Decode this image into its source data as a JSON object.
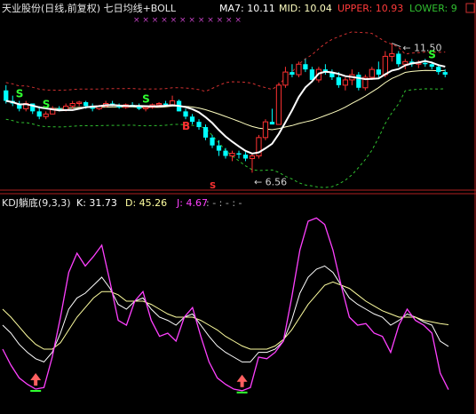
{
  "header": {
    "title": "天业股份(日线,前复权) 七日均线+BOLL",
    "ma7_label": "MA7: 10.11",
    "mid_label": "MID: 10.04",
    "upper_label": "UPPER: 10.93",
    "lower_label": "LOWER: 9",
    "header_marks": "× × × × × × × × × × × ×"
  },
  "kdj_header": {
    "name": "KDJ躺底(9,3,3)",
    "k_label": "K: 31.73",
    "d_label": "D: 45.26",
    "j_label": "J: 4.67",
    "tail": ": - : - : -"
  },
  "colors": {
    "bg": "#000000",
    "up": "#ff3232",
    "down": "#00ffff",
    "ma7": "#ffffff",
    "mid": "#ffffc0",
    "upper": "#d03030",
    "lower": "#30c030",
    "k": "#ffffff",
    "d": "#ffffa0",
    "j": "#ff40ff",
    "arrow_up": "#ff6060",
    "sell": "#30ff30"
  },
  "chart_data": [
    {
      "type": "candlestick",
      "title": "天业股份(日线,前复权) 七日均线+BOLL",
      "series": [
        {
          "name": "MA7",
          "last": 10.11
        },
        {
          "name": "MID",
          "last": 10.04
        },
        {
          "name": "UPPER",
          "last": 10.93
        },
        {
          "name": "LOWER",
          "last": 9
        }
      ],
      "annotations": [
        {
          "text": "11.50",
          "kind": "high"
        },
        {
          "text": "6.56",
          "kind": "low"
        }
      ],
      "signals": [
        "S",
        "S",
        "S",
        "B",
        "S"
      ],
      "ohlc": [
        [
          9.7,
          9.9,
          9.2,
          9.3
        ],
        [
          9.3,
          9.5,
          9.1,
          9.2
        ],
        [
          9.2,
          9.3,
          8.9,
          9.0
        ],
        [
          9.0,
          9.3,
          8.9,
          9.2
        ],
        [
          9.2,
          9.2,
          8.8,
          8.9
        ],
        [
          8.9,
          9.1,
          8.6,
          8.7
        ],
        [
          8.7,
          8.9,
          8.6,
          8.8
        ],
        [
          8.8,
          9.1,
          8.8,
          9.0
        ],
        [
          9.0,
          9.1,
          8.9,
          8.95
        ],
        [
          8.95,
          9.2,
          8.9,
          9.1
        ],
        [
          9.1,
          9.3,
          9.0,
          9.2
        ],
        [
          9.2,
          9.3,
          9.1,
          9.25
        ],
        [
          9.25,
          9.3,
          9.0,
          9.1
        ],
        [
          9.1,
          9.2,
          8.9,
          9.0
        ],
        [
          9.0,
          9.15,
          8.95,
          9.1
        ],
        [
          9.1,
          9.3,
          9.05,
          9.2
        ],
        [
          9.2,
          9.3,
          9.1,
          9.15
        ],
        [
          9.15,
          9.2,
          9.0,
          9.05
        ],
        [
          9.05,
          9.2,
          9.0,
          9.15
        ],
        [
          9.15,
          9.25,
          9.05,
          9.1
        ],
        [
          9.1,
          9.2,
          8.95,
          9.0
        ],
        [
          9.0,
          9.1,
          8.9,
          9.05
        ],
        [
          9.05,
          9.2,
          9.0,
          9.15
        ],
        [
          9.15,
          9.25,
          9.05,
          9.2
        ],
        [
          9.2,
          9.3,
          9.1,
          9.15
        ],
        [
          9.15,
          9.5,
          9.1,
          9.3
        ],
        [
          9.3,
          9.35,
          8.9,
          8.9
        ],
        [
          8.9,
          9.0,
          8.6,
          8.7
        ],
        [
          8.7,
          8.8,
          8.4,
          8.5
        ],
        [
          8.5,
          8.6,
          8.2,
          8.3
        ],
        [
          8.3,
          8.4,
          7.8,
          7.9
        ],
        [
          7.9,
          8.0,
          7.5,
          7.6
        ],
        [
          7.6,
          7.8,
          7.2,
          7.4
        ],
        [
          7.4,
          7.5,
          7.1,
          7.2
        ],
        [
          7.2,
          7.4,
          7.0,
          7.3
        ],
        [
          7.3,
          7.4,
          7.1,
          7.25
        ],
        [
          7.25,
          7.35,
          7.0,
          7.1
        ],
        [
          7.1,
          7.3,
          6.56,
          7.2
        ],
        [
          7.2,
          8.0,
          7.1,
          7.9
        ],
        [
          7.9,
          8.6,
          7.8,
          8.5
        ],
        [
          8.5,
          9.0,
          8.4,
          8.4
        ],
        [
          8.4,
          10.0,
          8.4,
          9.9
        ],
        [
          9.9,
          10.6,
          9.8,
          10.4
        ],
        [
          10.4,
          10.7,
          10.2,
          10.3
        ],
        [
          10.3,
          10.8,
          10.2,
          10.7
        ],
        [
          10.7,
          10.9,
          10.4,
          10.5
        ],
        [
          10.5,
          10.6,
          10.0,
          10.1
        ],
        [
          10.1,
          10.6,
          10.0,
          10.5
        ],
        [
          10.5,
          10.7,
          10.3,
          10.4
        ],
        [
          10.4,
          10.5,
          10.1,
          10.2
        ],
        [
          10.2,
          10.4,
          9.8,
          9.9
        ],
        [
          9.9,
          10.2,
          9.7,
          10.1
        ],
        [
          10.1,
          10.5,
          9.9,
          10.3
        ],
        [
          10.3,
          10.4,
          9.7,
          9.8
        ],
        [
          9.8,
          10.3,
          9.7,
          10.2
        ],
        [
          10.2,
          10.6,
          10.1,
          10.5
        ],
        [
          10.5,
          10.8,
          10.2,
          10.3
        ],
        [
          10.3,
          11.2,
          10.2,
          11.0
        ],
        [
          11.0,
          11.5,
          10.8,
          11.1
        ],
        [
          11.1,
          11.2,
          10.6,
          10.7
        ],
        [
          10.7,
          10.9,
          10.5,
          10.8
        ],
        [
          10.8,
          10.9,
          10.6,
          10.7
        ],
        [
          10.7,
          10.85,
          10.55,
          10.75
        ],
        [
          10.75,
          10.9,
          10.6,
          10.7
        ],
        [
          10.7,
          10.8,
          10.5,
          10.6
        ],
        [
          10.6,
          10.7,
          10.3,
          10.4
        ],
        [
          10.4,
          10.5,
          10.2,
          10.3
        ]
      ],
      "ylim": [
        6.2,
        12.2
      ]
    },
    {
      "type": "line",
      "title": "KDJ躺底(9,3,3)",
      "series": [
        {
          "name": "K",
          "last": 31.73,
          "values": [
            45,
            40,
            33,
            28,
            24,
            22,
            28,
            40,
            55,
            62,
            65,
            70,
            75,
            68,
            58,
            55,
            60,
            62,
            55,
            50,
            48,
            45,
            50,
            52,
            45,
            38,
            32,
            28,
            25,
            22,
            22,
            28,
            28,
            30,
            35,
            48,
            65,
            75,
            80,
            82,
            78,
            70,
            62,
            58,
            55,
            52,
            50,
            45,
            48,
            52,
            50,
            47,
            45,
            35,
            31.73
          ]
        },
        {
          "name": "D",
          "last": 45.26,
          "values": [
            55,
            50,
            44,
            38,
            33,
            30,
            30,
            34,
            42,
            50,
            56,
            62,
            66,
            66,
            64,
            60,
            60,
            60,
            58,
            55,
            52,
            50,
            50,
            50,
            48,
            45,
            42,
            38,
            35,
            32,
            30,
            30,
            30,
            32,
            36,
            42,
            50,
            58,
            64,
            70,
            72,
            70,
            68,
            64,
            60,
            57,
            54,
            52,
            50,
            50,
            50,
            48,
            47,
            46,
            45.26
          ]
        },
        {
          "name": "J",
          "last": 4.67,
          "values": [
            30,
            20,
            12,
            8,
            5,
            6,
            25,
            50,
            78,
            90,
            82,
            88,
            95,
            72,
            48,
            45,
            60,
            66,
            48,
            38,
            40,
            35,
            50,
            56,
            38,
            22,
            12,
            8,
            5,
            4,
            6,
            25,
            24,
            28,
            35,
            62,
            92,
            110,
            112,
            108,
            92,
            70,
            50,
            45,
            46,
            40,
            38,
            28,
            45,
            55,
            48,
            45,
            40,
            15,
            4.67
          ]
        }
      ],
      "ylim": [
        -5,
        115
      ]
    }
  ]
}
